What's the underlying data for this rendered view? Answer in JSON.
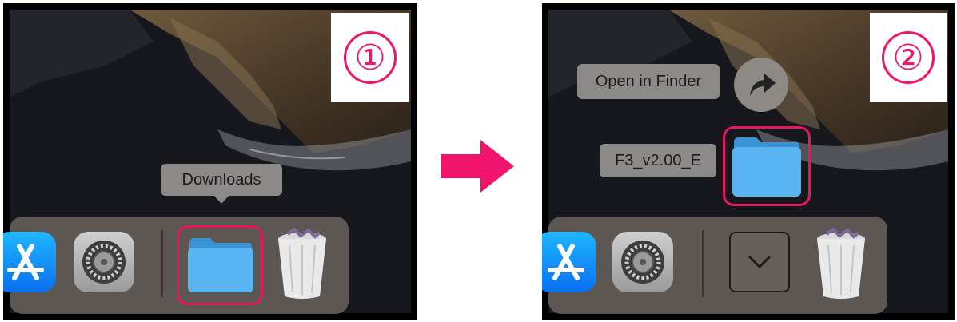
{
  "step1": {
    "badge": "①",
    "tooltip": "Downloads",
    "dock_icons": [
      "app-store-icon",
      "system-settings-icon",
      "downloads-folder-icon",
      "trash-icon"
    ]
  },
  "step2": {
    "badge": "②",
    "open_in_finder_label": "Open in Finder",
    "folder_label": "F3_v2.00_E",
    "dock_icons": [
      "app-store-icon",
      "system-settings-icon",
      "stack-collapse-icon",
      "trash-icon"
    ]
  },
  "colors": {
    "highlight": "#e8175d",
    "badge": "#f0146c",
    "arrow": "#f0146c",
    "folder": "#5ab4f2"
  }
}
